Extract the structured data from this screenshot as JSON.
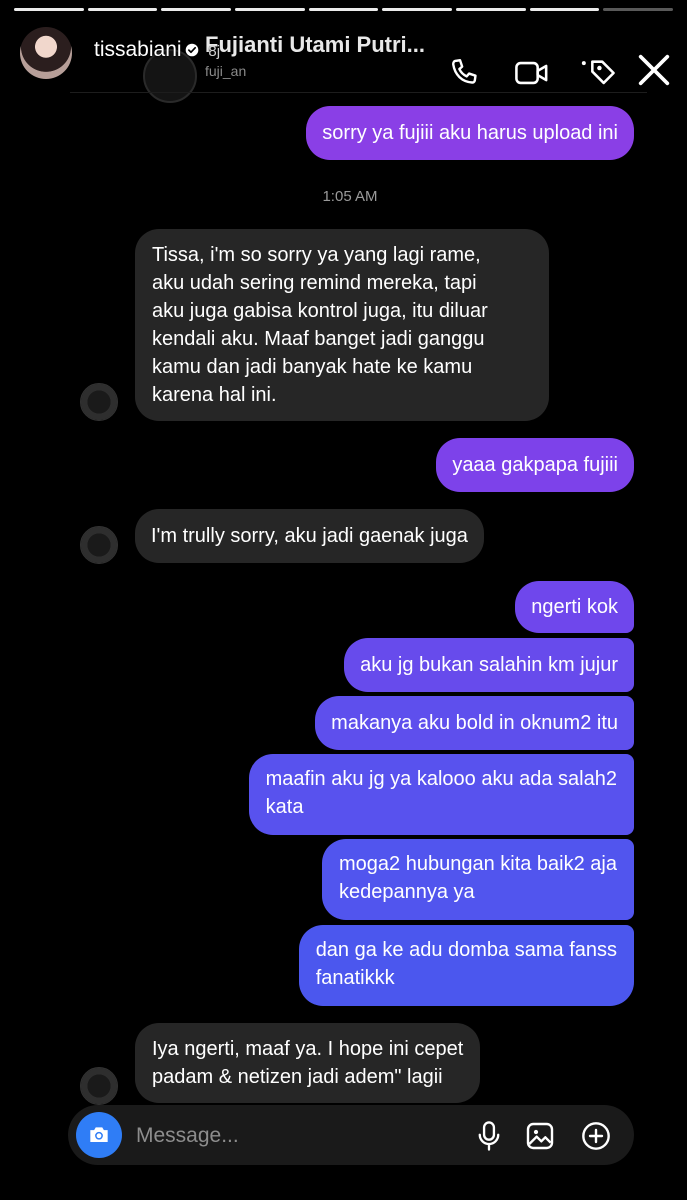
{
  "story": {
    "username": "tissabiani",
    "progress_segments": 9,
    "seen_segments": 8,
    "overlay_time_fragment": "8j"
  },
  "dm": {
    "back_icon": "chevron-left-icon",
    "name": "Fujianti Utami Putri...",
    "handle": "fuji_an"
  },
  "header_icons": [
    "phone-icon",
    "video-camera-icon",
    "tag-icon",
    "close-icon"
  ],
  "conversation": {
    "timestamp": "1:05 AM",
    "messages": [
      {
        "side": "out",
        "text": "sorry ya fujiii aku harus upload ini"
      },
      {
        "side": "in",
        "text": "Tissa, i'm so sorry ya yang lagi rame,\naku udah sering remind mereka, tapi\naku juga gabisa kontrol juga, itu diluar\nkendali aku. Maaf banget jadi ganggu\nkamu dan jadi  banyak hate ke kamu\nkarena hal ini."
      },
      {
        "side": "out",
        "text": "yaaa gakpapa fujiii"
      },
      {
        "side": "in",
        "text": "I'm trully sorry, aku jadi gaenak juga"
      },
      {
        "side": "out",
        "text": "ngerti kok"
      },
      {
        "side": "out",
        "text": "aku jg bukan salahin km jujur"
      },
      {
        "side": "out",
        "text": "makanya aku bold in oknum2 itu"
      },
      {
        "side": "out",
        "text": "maafin aku jg ya kalooo aku ada salah2\nkata"
      },
      {
        "side": "out",
        "text": "moga2 hubungan kita baik2 aja\nkedepannya ya"
      },
      {
        "side": "out",
        "text": "dan ga ke adu domba sama fanss\nfanatikkk"
      },
      {
        "side": "in",
        "text": "Iya ngerti, maaf ya. I hope ini cepet\npadam & netizen jadi adem\" lagii"
      }
    ]
  },
  "composer": {
    "placeholder": "Message...",
    "icons": [
      "camera-icon",
      "microphone-icon",
      "image-icon",
      "plus-circle-icon"
    ]
  },
  "colors": {
    "background": "#000000",
    "outgoing_top": "#8b3fe3",
    "outgoing_bottom": "#4a58ee",
    "incoming": "#262626",
    "camera_button": "#2f7df6"
  }
}
